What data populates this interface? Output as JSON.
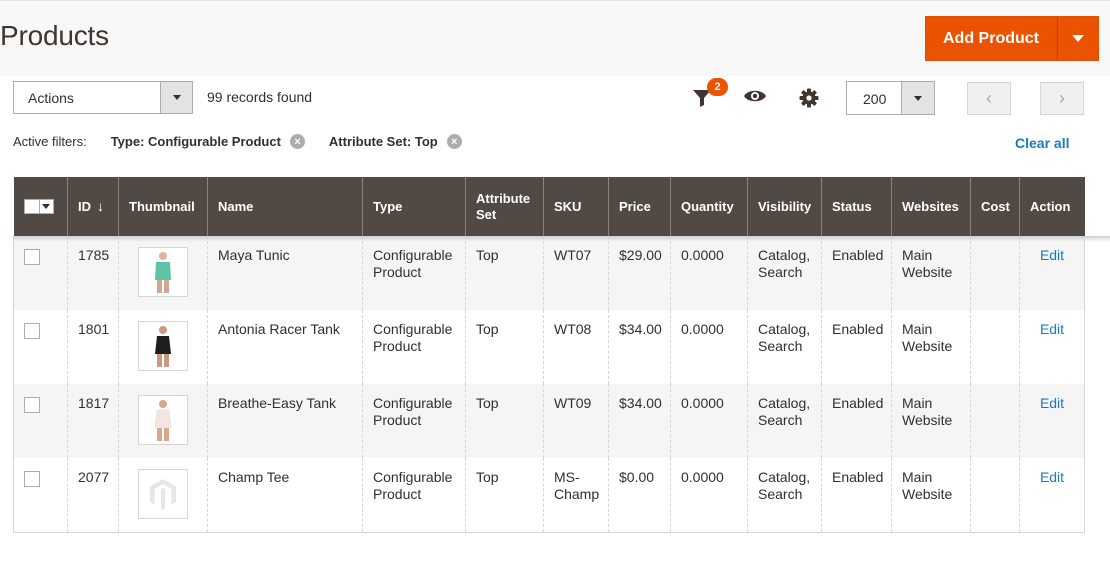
{
  "page": {
    "title": "Products",
    "add_button": "Add Product"
  },
  "toolbar": {
    "actions_label": "Actions",
    "records_found": "99 records found",
    "filter_count": "2",
    "per_page": "200",
    "prev_glyph": "‹",
    "next_glyph": "›"
  },
  "filters": {
    "label": "Active filters:",
    "items": [
      {
        "text": "Type: Configurable Product"
      },
      {
        "text": "Attribute Set: Top"
      }
    ],
    "clear_all": "Clear all"
  },
  "grid": {
    "columns": [
      "ID",
      "Thumbnail",
      "Name",
      "Type",
      "Attribute Set",
      "SKU",
      "Price",
      "Quantity",
      "Visibility",
      "Status",
      "Websites",
      "Cost",
      "Action"
    ],
    "sort_indicator": "↓",
    "rows": [
      {
        "id": "1785",
        "name": "Maya Tunic",
        "type": "Configurable Product",
        "attribute_set": "Top",
        "sku": "WT07",
        "price": "$29.00",
        "quantity": "0.0000",
        "visibility": "Catalog, Search",
        "status": "Enabled",
        "websites": "Main Website",
        "cost": "",
        "action": "Edit",
        "thumb_color": "#5fc4a5"
      },
      {
        "id": "1801",
        "name": "Antonia Racer Tank",
        "type": "Configurable Product",
        "attribute_set": "Top",
        "sku": "WT08",
        "price": "$34.00",
        "quantity": "0.0000",
        "visibility": "Catalog, Search",
        "status": "Enabled",
        "websites": "Main Website",
        "cost": "",
        "action": "Edit",
        "thumb_color": "#1e1e1e"
      },
      {
        "id": "1817",
        "name": "Breathe-Easy Tank",
        "type": "Configurable Product",
        "attribute_set": "Top",
        "sku": "WT09",
        "price": "$34.00",
        "quantity": "0.0000",
        "visibility": "Catalog, Search",
        "status": "Enabled",
        "websites": "Main Website",
        "cost": "",
        "action": "Edit",
        "thumb_color": "#f2f0ee"
      },
      {
        "id": "2077",
        "name": "Champ Tee",
        "type": "Configurable Product",
        "attribute_set": "Top",
        "sku": "MS-Champ",
        "price": "$0.00",
        "quantity": "0.0000",
        "visibility": "Catalog, Search",
        "status": "Enabled",
        "websites": "Main Website",
        "cost": "",
        "action": "Edit",
        "thumb_color": "placeholder"
      }
    ]
  },
  "colors": {
    "accent": "#eb5202",
    "header_bg": "#514943",
    "link": "#1979c3"
  }
}
